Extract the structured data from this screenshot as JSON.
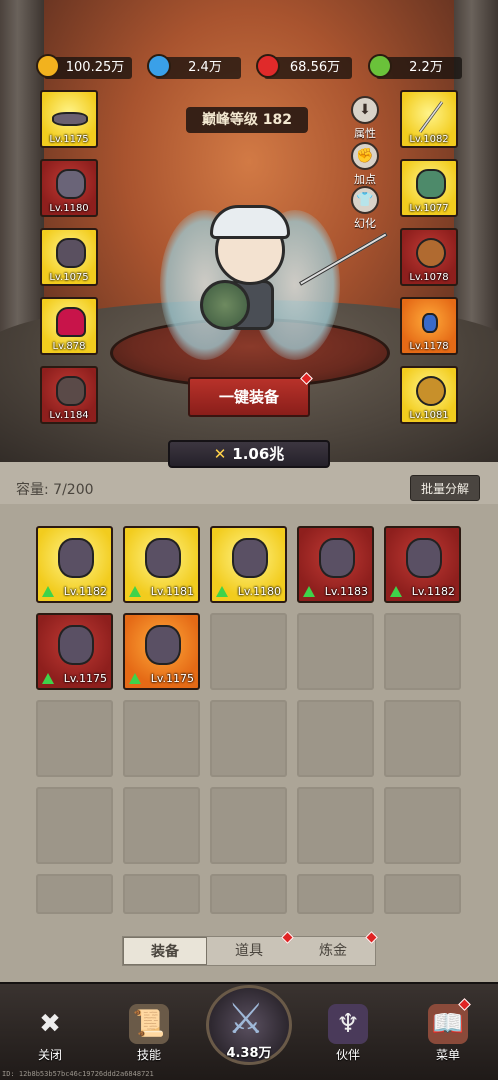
{
  "currencies": [
    {
      "icon": "gold-coin-icon",
      "value": "100.25万",
      "color": "#f2b21e"
    },
    {
      "icon": "blue-gem-icon",
      "value": "2.4万",
      "color": "#3aa0e8"
    },
    {
      "icon": "red-gem-icon",
      "value": "68.56万",
      "color": "#e02a2a"
    },
    {
      "icon": "green-scroll-icon",
      "value": "2.2万",
      "color": "#6ac23a"
    }
  ],
  "level_label": "巅峰等级 182",
  "side_buttons": [
    "属性",
    "加点",
    "幻化"
  ],
  "left_slots": [
    {
      "level": "Lv.1175",
      "rarity": "y",
      "icon": "belt-icon"
    },
    {
      "level": "Lv.1180",
      "rarity": "r",
      "icon": "shield-icon"
    },
    {
      "level": "Lv.1075",
      "rarity": "y",
      "icon": "chest-armor-icon"
    },
    {
      "level": "Lv.878",
      "rarity": "y",
      "icon": "boots-icon"
    },
    {
      "level": "Lv.1184",
      "rarity": "r",
      "icon": "boots-icon"
    }
  ],
  "right_slots": [
    {
      "level": "Lv.1082",
      "rarity": "y",
      "icon": "sword-icon"
    },
    {
      "level": "Lv.1077",
      "rarity": "y",
      "icon": "shoulder-armor-icon"
    },
    {
      "level": "Lv.1078",
      "rarity": "r",
      "icon": "ring-icon"
    },
    {
      "level": "Lv.1178",
      "rarity": "o",
      "icon": "necklace-icon"
    },
    {
      "level": "Lv.1081",
      "rarity": "y",
      "icon": "amulet-icon"
    }
  ],
  "equip_all_label": "一键装备",
  "power": "1.06兆",
  "bag": {
    "capacity": "容量: 7/200",
    "dismantle_label": "批量分解",
    "items": [
      {
        "level": "Lv.1182",
        "rarity": "y",
        "icon": "helmet-icon"
      },
      {
        "level": "Lv.1181",
        "rarity": "y",
        "icon": "sword-icon"
      },
      {
        "level": "Lv.1180",
        "rarity": "y",
        "icon": "boots-icon"
      },
      {
        "level": "Lv.1183",
        "rarity": "r",
        "icon": "necklace-icon"
      },
      {
        "level": "Lv.1182",
        "rarity": "r",
        "icon": "ring-icon"
      },
      {
        "level": "Lv.1175",
        "rarity": "r",
        "icon": "shield-icon"
      },
      {
        "level": "Lv.1175",
        "rarity": "o",
        "icon": "boots-icon"
      }
    ]
  },
  "tabs": [
    "装备",
    "道具",
    "炼金"
  ],
  "nav": {
    "close": "关闭",
    "skills": "技能",
    "center_value": "4.38万",
    "partner": "伙伴",
    "menu": "菜单"
  },
  "id_text": "ID: 12b8b53b57bc46c19726ddd2a6848721"
}
